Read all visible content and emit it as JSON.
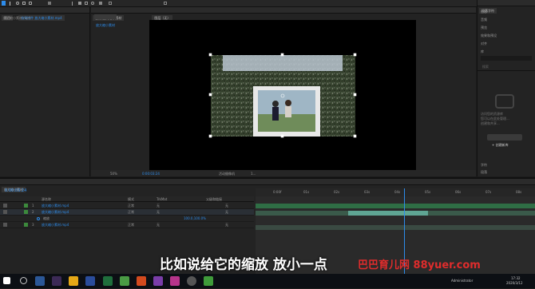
{
  "project_panel": {
    "tabs": [
      "项目",
      "效果控件 放大缩小素材.mp4"
    ],
    "file_item": "放大缩小素材.mp4"
  },
  "composition_panel": {
    "tab_label": "合成 放大缩小素材",
    "sub_tab": "放大缩小素材",
    "layer_tab": "图层（无）",
    "zoom": "50%",
    "timecode": "0:00:03:24",
    "view": "活动摄像机",
    "views_count": "1..."
  },
  "right_panel": {
    "title": "段落字符",
    "items": [
      "信息",
      "音频",
      "预览",
      "效果和预设",
      "对齐",
      "库"
    ],
    "library_search_placeholder": "搜索",
    "help_lines": [
      "访问您的资源库",
      "您可以在此处管理...",
      "创建和共享...",
      "Adobe..."
    ],
    "create_button": "+ 创建新库",
    "bottom_items": [
      "字符",
      "段落"
    ]
  },
  "timeline": {
    "tab": "放大缩小素材",
    "timecode": "0:00:03:24",
    "columns": [
      "源名称",
      "模式",
      "TrkMat",
      "父级和链接"
    ],
    "layers": [
      {
        "num": "1",
        "name": "放大缩小素材.mp4",
        "mode": "正常",
        "trk": "无",
        "parent": "无",
        "color": "#3c8a3c",
        "expanded": false
      },
      {
        "num": "2",
        "name": "放大缩小素材.mp4",
        "mode": "正常",
        "trk": "无",
        "parent": "无",
        "color": "#3c8a3c",
        "expanded": true
      },
      {
        "num": "",
        "name": "缩放",
        "mode": "",
        "trk": "",
        "parent": "",
        "color": "#2a2a2a",
        "expanded": false
      },
      {
        "num": "3",
        "name": "放大缩小素材.mp4",
        "mode": "正常",
        "trk": "无",
        "parent": "无",
        "color": "#3c8a3c",
        "expanded": false
      }
    ],
    "scale_value": "100.0,100.0%",
    "ruler_labels": [
      "0:00f",
      "01s",
      "02s",
      "03s",
      "04s",
      "05s",
      "06s",
      "07s",
      "08s"
    ],
    "playhead_fraction": 0.53
  },
  "subtitle": "比如说给它的缩放 放小一点",
  "watermark": "巴巴育儿网 88yuer.com",
  "taskbar": {
    "user": "Administrator",
    "time": "17:32",
    "date": "2020/3/12"
  },
  "colors": {
    "accent": "#2d8ceb",
    "layer_green": "#3c8a3c",
    "track_teal": "#5fa593"
  }
}
